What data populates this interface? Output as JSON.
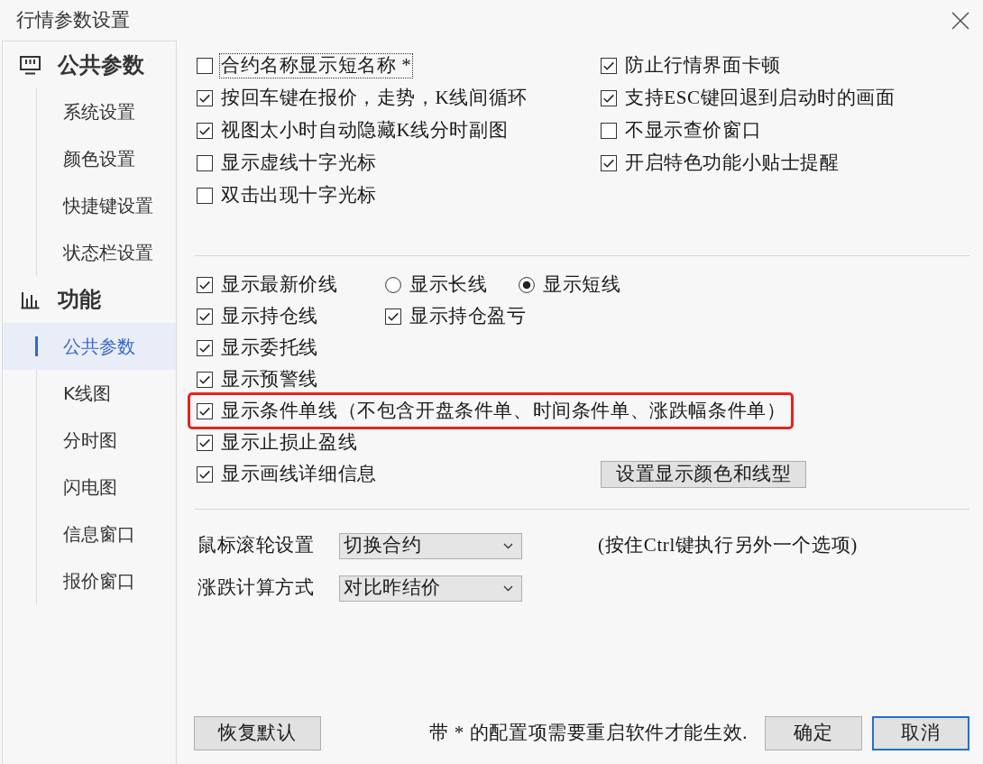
{
  "window": {
    "title": "行情参数设置"
  },
  "sidebar": {
    "groups": [
      {
        "label": "公共参数",
        "items": [
          {
            "label": "系统设置",
            "selected": false
          },
          {
            "label": "颜色设置",
            "selected": false
          },
          {
            "label": "快捷键设置",
            "selected": false
          },
          {
            "label": "状态栏设置",
            "selected": false
          }
        ]
      },
      {
        "label": "功能",
        "items": [
          {
            "label": "公共参数",
            "selected": true
          },
          {
            "label": "K线图",
            "selected": false
          },
          {
            "label": "分时图",
            "selected": false
          },
          {
            "label": "闪电图",
            "selected": false
          },
          {
            "label": "信息窗口",
            "selected": false
          },
          {
            "label": "报价窗口",
            "selected": false
          }
        ]
      }
    ]
  },
  "general_options": {
    "left": [
      {
        "label": "合约名称显示短名称 *",
        "checked": false,
        "focused": true
      },
      {
        "label": "按回车键在报价，走势，K线间循环",
        "checked": true,
        "focused": false
      },
      {
        "label": "视图太小时自动隐藏K线分时副图",
        "checked": true,
        "focused": false
      },
      {
        "label": "显示虚线十字光标",
        "checked": false,
        "focused": false
      },
      {
        "label": "双击出现十字光标",
        "checked": false,
        "focused": false
      }
    ],
    "right": [
      {
        "label": "防止行情界面卡顿",
        "checked": true,
        "focused": false
      },
      {
        "label": "支持ESC键回退到启动时的画面",
        "checked": true,
        "focused": false
      },
      {
        "label": "不显示查价窗口",
        "checked": false,
        "focused": false
      },
      {
        "label": "开启特色功能小贴士提醒",
        "checked": true,
        "focused": false
      }
    ]
  },
  "line_options": [
    {
      "highlighted": false,
      "controls": [
        {
          "kind": "checkbox",
          "label": "显示最新价线",
          "checked": true
        },
        {
          "kind": "radio",
          "label": "显示长线",
          "selected": false
        },
        {
          "kind": "radio",
          "label": "显示短线",
          "selected": true
        }
      ]
    },
    {
      "highlighted": false,
      "controls": [
        {
          "kind": "checkbox",
          "label": "显示持仓线",
          "checked": true
        },
        {
          "kind": "checkbox",
          "label": "显示持仓盈亏",
          "checked": true
        }
      ]
    },
    {
      "highlighted": false,
      "controls": [
        {
          "kind": "checkbox",
          "label": "显示委托线",
          "checked": true
        }
      ]
    },
    {
      "highlighted": false,
      "controls": [
        {
          "kind": "checkbox",
          "label": "显示预警线",
          "checked": true
        }
      ]
    },
    {
      "highlighted": true,
      "controls": [
        {
          "kind": "checkbox",
          "label": "显示条件单线（不包含开盘条件单、时间条件单、涨跌幅条件单）",
          "checked": true
        }
      ]
    },
    {
      "highlighted": false,
      "controls": [
        {
          "kind": "checkbox",
          "label": "显示止损止盈线",
          "checked": true
        }
      ]
    },
    {
      "highlighted": false,
      "controls": [
        {
          "kind": "checkbox",
          "label": "显示画线详细信息",
          "checked": true
        },
        {
          "kind": "button",
          "label": "设置显示颜色和线型"
        }
      ]
    }
  ],
  "dropdown_settings": [
    {
      "label": "鼠标滚轮设置",
      "value": "切换合约",
      "note": "(按住Ctrl键执行另外一个选项)"
    },
    {
      "label": "涨跌计算方式",
      "value": "对比昨结价"
    }
  ],
  "footer": {
    "reset_button": "恢复默认",
    "note": "带 * 的配置项需要重启软件才能生效.",
    "buttons": [
      {
        "label": "确定",
        "focused": false
      },
      {
        "label": "取消",
        "focused": true
      }
    ]
  }
}
